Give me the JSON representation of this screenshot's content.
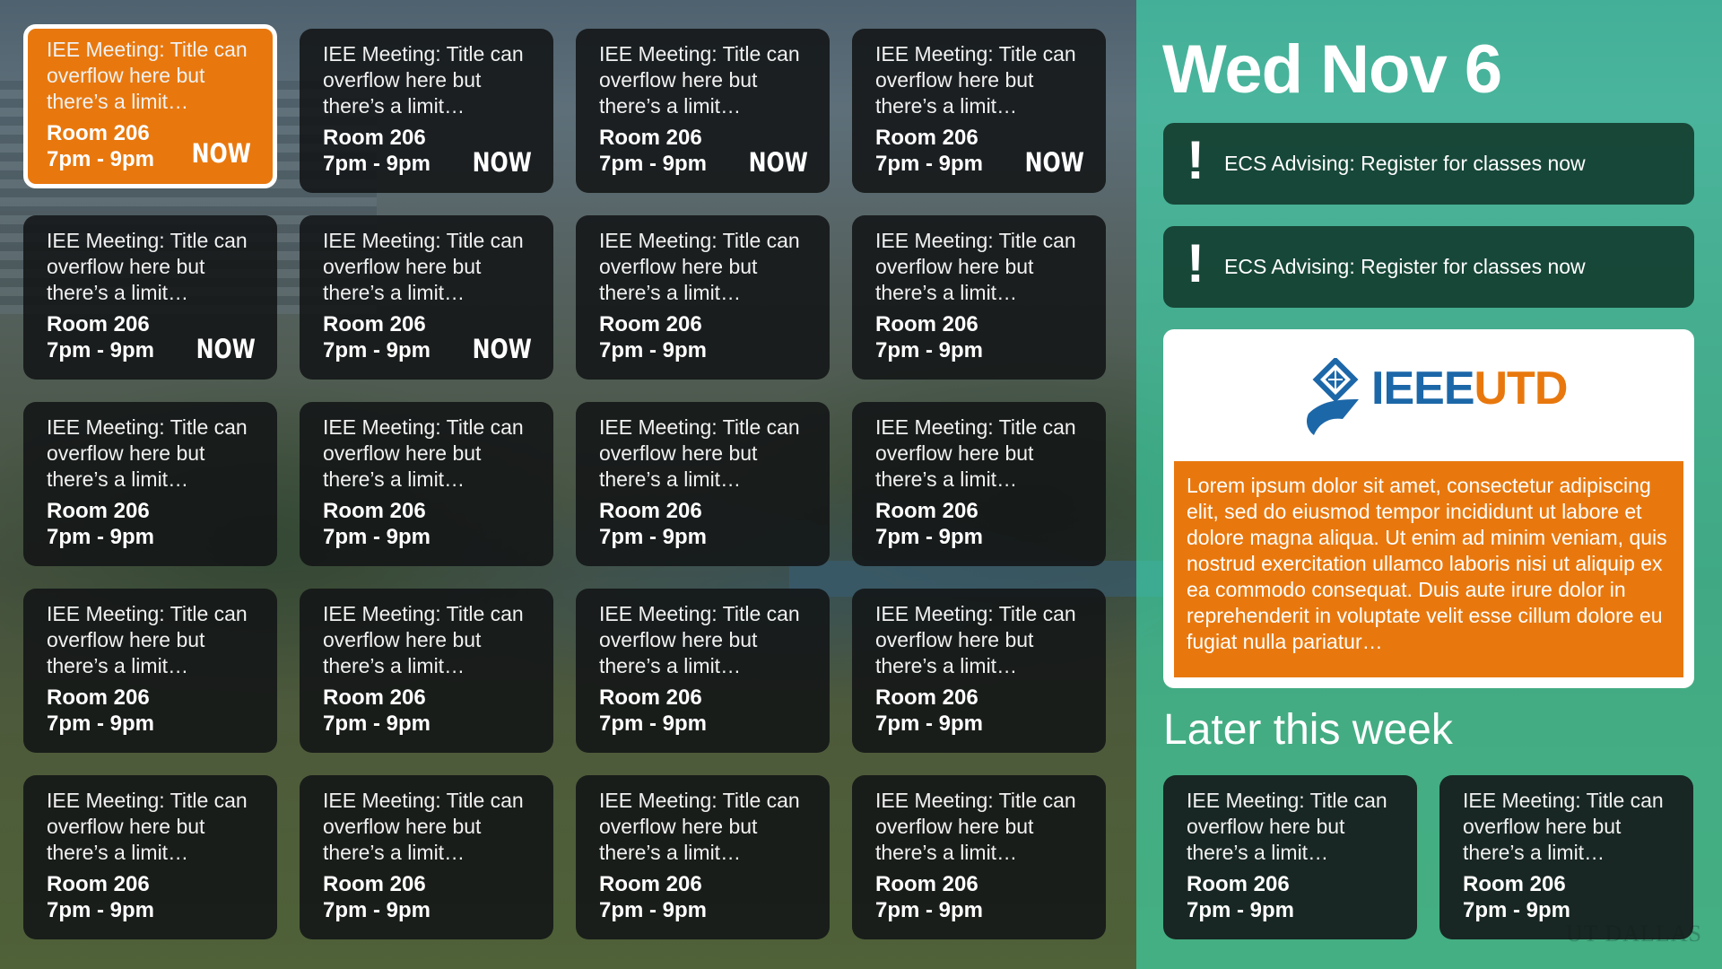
{
  "date": "Wed Nov 6",
  "events": [
    {
      "title": "IEE Meeting: Title can overflow here but there’s a limit…",
      "room": "Room 206",
      "time": "7pm - 9pm",
      "badge": "NOW"
    },
    {
      "title": "IEE Meeting: Title can overflow here but there’s a limit…",
      "room": "Room 206",
      "time": "7pm - 9pm",
      "badge": "NOW"
    },
    {
      "title": "IEE Meeting: Title can overflow here but there’s a limit…",
      "room": "Room 206",
      "time": "7pm - 9pm",
      "badge": "NOW"
    },
    {
      "title": "IEE Meeting: Title can overflow here but there’s a limit…",
      "room": "Room 206",
      "time": "7pm - 9pm",
      "badge": "NOW"
    },
    {
      "title": "IEE Meeting: Title can overflow here but there’s a limit…",
      "room": "Room 206",
      "time": "7pm - 9pm",
      "badge": "NOW"
    },
    {
      "title": "IEE Meeting: Title can overflow here but there’s a limit…",
      "room": "Room 206",
      "time": "7pm - 9pm",
      "badge": "NOW"
    },
    {
      "title": "IEE Meeting: Title can overflow here but there’s a limit…",
      "room": "Room 206",
      "time": "7pm - 9pm",
      "badge": ""
    },
    {
      "title": "IEE Meeting: Title can overflow here but there’s a limit…",
      "room": "Room 206",
      "time": "7pm - 9pm",
      "badge": ""
    },
    {
      "title": "IEE Meeting: Title can overflow here but there’s a limit…",
      "room": "Room 206",
      "time": "7pm - 9pm",
      "badge": ""
    },
    {
      "title": "IEE Meeting: Title can overflow here but there’s a limit…",
      "room": "Room 206",
      "time": "7pm - 9pm",
      "badge": ""
    },
    {
      "title": "IEE Meeting: Title can overflow here but there’s a limit…",
      "room": "Room 206",
      "time": "7pm - 9pm",
      "badge": ""
    },
    {
      "title": "IEE Meeting: Title can overflow here but there’s a limit…",
      "room": "Room 206",
      "time": "7pm - 9pm",
      "badge": ""
    },
    {
      "title": "IEE Meeting: Title can overflow here but there’s a limit…",
      "room": "Room 206",
      "time": "7pm - 9pm",
      "badge": ""
    },
    {
      "title": "IEE Meeting: Title can overflow here but there’s a limit…",
      "room": "Room 206",
      "time": "7pm - 9pm",
      "badge": ""
    },
    {
      "title": "IEE Meeting: Title can overflow here but there’s a limit…",
      "room": "Room 206",
      "time": "7pm - 9pm",
      "badge": ""
    },
    {
      "title": "IEE Meeting: Title can overflow here but there’s a limit…",
      "room": "Room 206",
      "time": "7pm - 9pm",
      "badge": ""
    },
    {
      "title": "IEE Meeting: Title can overflow here but there’s a limit…",
      "room": "Room 206",
      "time": "7pm - 9pm",
      "badge": ""
    },
    {
      "title": "IEE Meeting: Title can overflow here but there’s a limit…",
      "room": "Room 206",
      "time": "7pm - 9pm",
      "badge": ""
    },
    {
      "title": "IEE Meeting: Title can overflow here but there’s a limit…",
      "room": "Room 206",
      "time": "7pm - 9pm",
      "badge": ""
    },
    {
      "title": "IEE Meeting: Title can overflow here but there’s a limit…",
      "room": "Room 206",
      "time": "7pm - 9pm",
      "badge": ""
    }
  ],
  "selected_index": 0,
  "alerts": [
    {
      "icon": "exclamation-icon",
      "text": "ECS Advising: Register for classes now"
    },
    {
      "icon": "exclamation-icon",
      "text": "ECS Advising: Register for classes now"
    }
  ],
  "featured": {
    "logo_part1": "IEEE",
    "logo_part2": "UTD",
    "body": "Lorem ipsum dolor sit amet, consectetur adipiscing elit, sed do eiusmod tempor incididunt ut labore et dolore magna aliqua. Ut enim ad minim veniam, quis nostrud exercitation ullamco laboris nisi ut aliquip ex ea commodo consequat. Duis aute irure dolor in reprehenderit in voluptate velit esse cillum dolore eu fugiat nulla pariatur…"
  },
  "later_heading": "Later this week",
  "later_events": [
    {
      "title": "IEE Meeting: Title can overflow here but there’s a limit…",
      "room": "Room 206",
      "time": "7pm - 9pm"
    },
    {
      "title": "IEE Meeting: Title can overflow here but there’s a limit…",
      "room": "Room 206",
      "time": "7pm - 9pm"
    }
  ],
  "watermark": "UT DALLAS",
  "colors": {
    "accent": "#e8780e",
    "panel": "#38ba96",
    "alert_bg": "#143e30",
    "card_bg": "#121416",
    "ieee_blue": "#1c67a8"
  }
}
